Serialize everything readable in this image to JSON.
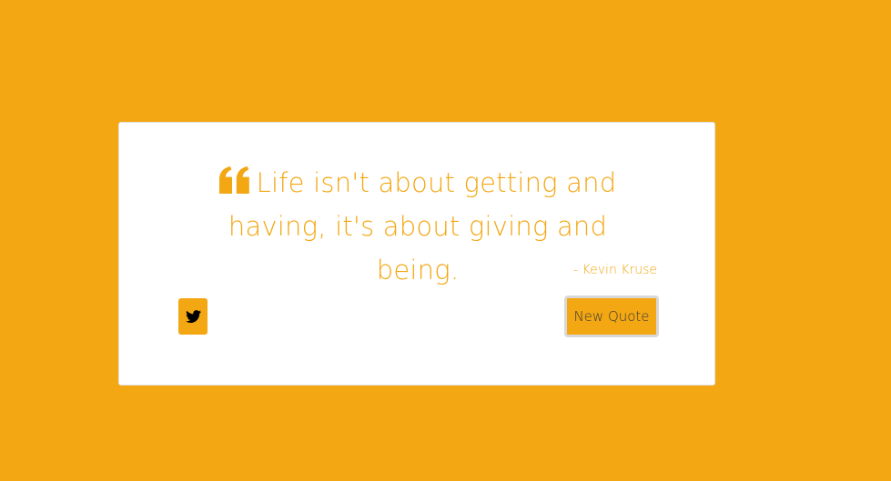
{
  "quote": {
    "text": "Life isn't about getting and having, it's about giving and being.",
    "author": "- Kevin Kruse",
    "icon": "quote-left-icon"
  },
  "actions": {
    "tweet_icon": "twitter-icon",
    "new_quote_label": "New Quote"
  },
  "colors": {
    "accent": "#f3a712",
    "card_background": "#ffffff",
    "button_text": "#3a3a3a"
  }
}
